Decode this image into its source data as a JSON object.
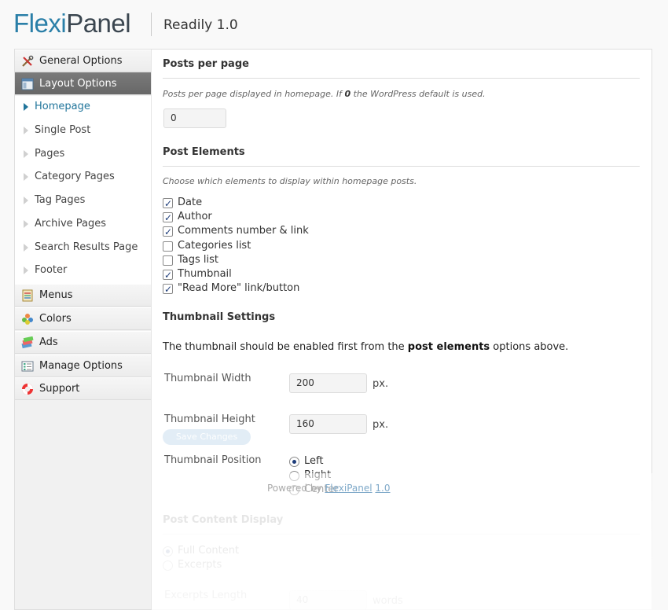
{
  "header": {
    "logo_part1": "Flexi",
    "logo_part2": "Panel",
    "theme_version": "Readily 1.0"
  },
  "sidebar": {
    "main_items": [
      {
        "label": "General Options",
        "icon": "tools-icon"
      },
      {
        "label": "Layout Options",
        "icon": "layout-icon",
        "active": true
      },
      {
        "label": "Menus",
        "icon": "menus-icon"
      },
      {
        "label": "Colors",
        "icon": "colors-icon"
      },
      {
        "label": "Ads",
        "icon": "ads-icon"
      },
      {
        "label": "Manage Options",
        "icon": "manage-icon"
      },
      {
        "label": "Support",
        "icon": "lifebuoy-icon"
      }
    ],
    "sub_items": [
      {
        "label": "Homepage",
        "active": true
      },
      {
        "label": "Single Post"
      },
      {
        "label": "Pages"
      },
      {
        "label": "Category Pages"
      },
      {
        "label": "Tag Pages"
      },
      {
        "label": "Archive Pages"
      },
      {
        "label": "Search Results Page"
      },
      {
        "label": "Footer"
      }
    ]
  },
  "posts_per_page": {
    "title": "Posts per page",
    "desc_pre": "Posts per page displayed in homepage. If ",
    "desc_bold": "0",
    "desc_post": " the WordPress default is used.",
    "value": "0"
  },
  "post_elements": {
    "title": "Post Elements",
    "desc": "Choose which elements to display within homepage posts.",
    "items": [
      {
        "label": "Date",
        "checked": true
      },
      {
        "label": "Author",
        "checked": true
      },
      {
        "label": "Comments number & link",
        "checked": true
      },
      {
        "label": "Categories list",
        "checked": false
      },
      {
        "label": "Tags list",
        "checked": false
      },
      {
        "label": "Thumbnail",
        "checked": true
      },
      {
        "label": "\"Read More\" link/button",
        "checked": true
      }
    ]
  },
  "thumbnail": {
    "title": "Thumbnail Settings",
    "note_pre": "The thumbnail should be enabled first from the ",
    "note_bold": "post elements",
    "note_post": " options above.",
    "width_label": "Thumbnail Width",
    "width_value": "200",
    "height_label": "Thumbnail Height",
    "height_value": "160",
    "unit": "px.",
    "position_label": "Thumbnail Position",
    "positions": [
      {
        "label": "Left",
        "checked": true
      },
      {
        "label": "Right",
        "checked": false
      },
      {
        "label": "Center",
        "checked": false
      }
    ]
  },
  "post_content": {
    "title": "Post Content Display",
    "options": [
      {
        "label": "Full Content",
        "checked": true
      },
      {
        "label": "Excerpts",
        "checked": false
      }
    ],
    "excerpt_label": "Excerpts Length",
    "excerpt_value": "40",
    "excerpt_unit": "words"
  },
  "footer": {
    "powered_prefix": "Powered by ",
    "powered_link": "FlexiPanel",
    "version_link": "1.0"
  },
  "ghost_button": "Save Changes"
}
